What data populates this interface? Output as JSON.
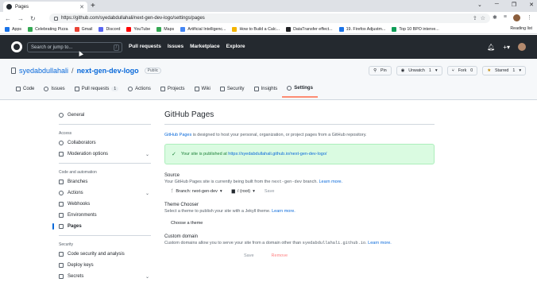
{
  "browser": {
    "tab_title": "Pages",
    "url": "https://github.com/syedabdullahali/next-gen-dev-logo/settings/pages",
    "bookmarks": [
      {
        "label": "Apps",
        "color": "#1a73e8"
      },
      {
        "label": "Celebrating Pizza",
        "color": "#34a853"
      },
      {
        "label": "Gmail",
        "color": "#ea4335"
      },
      {
        "label": "Discord",
        "color": "#5865f2"
      },
      {
        "label": "YouTube",
        "color": "#ff0000"
      },
      {
        "label": "Maps",
        "color": "#34a853"
      },
      {
        "label": "Artificial Intelligenc...",
        "color": "#4285f4"
      },
      {
        "label": "How to Build a Calc...",
        "color": "#f4b400"
      },
      {
        "label": "DataTransfer effect...",
        "color": "#202124"
      },
      {
        "label": "19. Firefox Adjustm...",
        "color": "#1a73e8"
      },
      {
        "label": "Top 10 BPO interve...",
        "color": "#0f9d58"
      }
    ],
    "reading_list": "Reading list"
  },
  "github": {
    "search_placeholder": "Search or jump to...",
    "search_key": "/",
    "nav": [
      "Pull requests",
      "Issues",
      "Marketplace",
      "Explore"
    ]
  },
  "repo": {
    "owner": "syedabdullahali",
    "separator": "/",
    "name": "next-gen-dev-logo",
    "visibility": "Public",
    "actions": {
      "pin": "Pin",
      "unwatch": "Unwatch",
      "unwatch_count": "1",
      "fork": "Fork",
      "fork_count": "0",
      "starred": "Starred",
      "starred_count": "1"
    },
    "tabs": [
      {
        "label": "Code",
        "count": ""
      },
      {
        "label": "Issues",
        "count": ""
      },
      {
        "label": "Pull requests",
        "count": "1"
      },
      {
        "label": "Actions",
        "count": ""
      },
      {
        "label": "Projects",
        "count": ""
      },
      {
        "label": "Wiki",
        "count": ""
      },
      {
        "label": "Security",
        "count": ""
      },
      {
        "label": "Insights",
        "count": ""
      },
      {
        "label": "Settings",
        "count": ""
      }
    ]
  },
  "sidebar": {
    "general": "General",
    "access_heading": "Access",
    "collaborators": "Collaborators",
    "moderation": "Moderation options",
    "code_heading": "Code and automation",
    "branches": "Branches",
    "actions": "Actions",
    "webhooks": "Webhooks",
    "environments": "Environments",
    "pages": "Pages",
    "security_heading": "Security",
    "code_security": "Code security and analysis",
    "deploy_keys": "Deploy keys",
    "secrets": "Secrets"
  },
  "pages": {
    "title": "GitHub Pages",
    "lead_link": "GitHub Pages",
    "lead_text": " is designed to host your personal, organization, or project pages from a GitHub repository.",
    "published_text": "Your site is published at ",
    "published_url": "https://syedabdullahali.github.io/next-gen-dev-logo/",
    "source_title": "Source",
    "source_desc_1": "Your GitHub Pages site is currently being built from the ",
    "source_branch_code": "next-gen-dev",
    "source_desc_2": " branch. ",
    "learn_more": "Learn more.",
    "branch_select": "Branch: next-gen-dev",
    "folder_select": "/ (root)",
    "save": "Save",
    "theme_title": "Theme Chooser",
    "theme_desc": "Select a theme to publish your site with a Jekyll theme. ",
    "choose_theme": "Choose a theme",
    "domain_title": "Custom domain",
    "domain_desc_1": "Custom domains allow you to serve your site from a domain other than ",
    "domain_code": "syedabdullahali.github.io",
    "domain_desc_2": ". ",
    "remove": "Remove"
  }
}
